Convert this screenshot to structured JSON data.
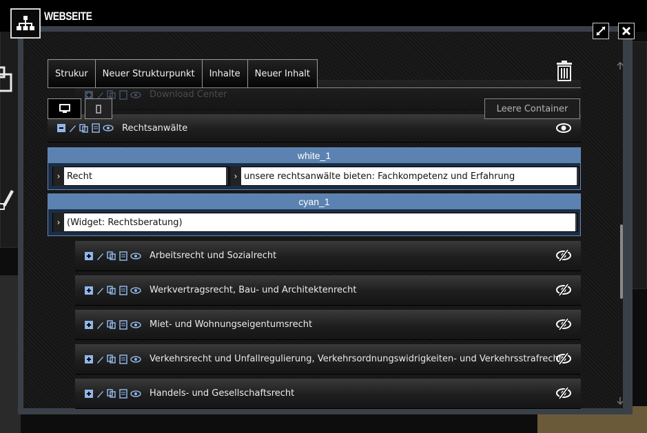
{
  "app": {
    "title": "WEBSEITE"
  },
  "tabs": [
    {
      "label": "Strukur"
    },
    {
      "label": "Neuer Strukturpunkt"
    },
    {
      "label": "Inhalte"
    },
    {
      "label": "Neuer Inhalt"
    }
  ],
  "toolbar": {
    "empty_containers_label": "Leere Container"
  },
  "tree": {
    "partial_item": "Download Center",
    "parent_item": "Rechtsanwälte",
    "children": [
      {
        "label": "Arbeitsrecht und Sozialrecht"
      },
      {
        "label": "Werkvertragsrecht, Bau- und Architektenrecht"
      },
      {
        "label": "Miet- und Wohnungseigentumsrecht"
      },
      {
        "label": "Verkehrsrecht und Unfallregulierung, Verkehrsordnungswidrigkeiten- und Verkehrsstrafrecht"
      },
      {
        "label": "Handels- und Gesellschaftsrecht"
      }
    ]
  },
  "containers": [
    {
      "name": "white_1",
      "cells": [
        "Recht",
        "unsere rechtsanwälte bieten: Fachkompetenz und Erfahrung"
      ]
    },
    {
      "name": "cyan_1",
      "cells": [
        "(Widget: Rechtsberatung)"
      ]
    }
  ],
  "colors": {
    "container_header": "#5b82b1",
    "icon_blue": "#8fb6e8"
  },
  "icons": [
    "sitemap-icon",
    "expand-icon",
    "close-icon",
    "trash-icon",
    "desktop-icon",
    "mobile-icon",
    "plus-icon",
    "minus-icon",
    "pencil-icon",
    "copy-icon",
    "document-icon",
    "eye-icon",
    "eye-hidden-icon"
  ]
}
